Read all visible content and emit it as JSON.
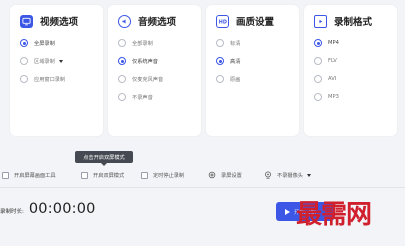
{
  "panels": {
    "video": {
      "title": "视频选项",
      "icon": "monitor-icon",
      "options": [
        {
          "label": "全屏录制",
          "selected": true,
          "has_dropdown": false
        },
        {
          "label": "区域录制",
          "selected": false,
          "has_dropdown": true
        },
        {
          "label": "应用窗口录制",
          "selected": false,
          "has_dropdown": false
        }
      ]
    },
    "audio": {
      "title": "音频选项",
      "icon": "speaker-icon",
      "options": [
        {
          "label": "全部录制",
          "selected": false
        },
        {
          "label": "仅系统声音",
          "selected": true
        },
        {
          "label": "仅麦克风声音",
          "selected": false
        },
        {
          "label": "不录声音",
          "selected": false
        }
      ]
    },
    "quality": {
      "title": "画质设置",
      "icon": "hd-icon",
      "options": [
        {
          "label": "标清",
          "selected": false
        },
        {
          "label": "高清",
          "selected": true
        },
        {
          "label": "原画",
          "selected": false
        }
      ]
    },
    "format": {
      "title": "录制格式",
      "icon": "file-video-icon",
      "options": [
        {
          "label": "MP4",
          "selected": true
        },
        {
          "label": "FLV",
          "selected": false
        },
        {
          "label": "AVI",
          "selected": false
        },
        {
          "label": "MP3",
          "selected": false
        }
      ]
    }
  },
  "tooltip": "点击开启双屏模式",
  "settings": {
    "desktop_tool": "开启屏幕画面工具",
    "screen_mode": "开启双屏模式",
    "timed_stop": "定时停止录制",
    "record_settings": "录屏设置",
    "camera": "不录摄像头"
  },
  "duration": {
    "label": "录制时长:",
    "value": "00:00:00"
  },
  "start_button": {
    "label": "开始录制"
  },
  "watermark": "最需网",
  "colors": {
    "accent": "#3c57e6",
    "watermark": "#d0202e",
    "background": "#f3f4f7"
  }
}
